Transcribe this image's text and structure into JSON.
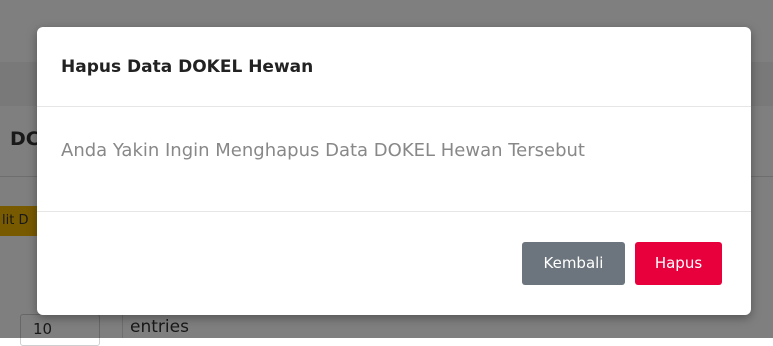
{
  "background": {
    "heading_fragment": "DC",
    "edit_button_fragment": "lit D",
    "length_value": "10",
    "entries_label": "entries"
  },
  "modal": {
    "title": "Hapus Data DOKEL Hewan",
    "message": "Anda Yakin Ingin Menghapus Data DOKEL Hewan Tersebut",
    "buttons": {
      "back_label": "Kembali",
      "delete_label": "Hapus"
    }
  },
  "colors": {
    "overlay": "rgba(0,0,0,0.5)",
    "secondary_button": "#6c757d",
    "danger_button": "#e8003d",
    "edit_button_bg": "#f0b400"
  }
}
